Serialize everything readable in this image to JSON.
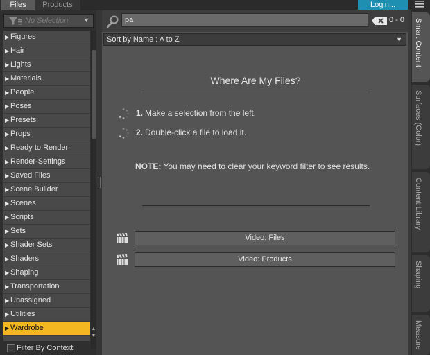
{
  "top_tabs": {
    "files": "Files",
    "products": "Products"
  },
  "login": {
    "label": "Login..."
  },
  "selection": {
    "placeholder": "No Selection"
  },
  "folders": [
    "Figures",
    "Hair",
    "Lights",
    "Materials",
    "People",
    "Poses",
    "Presets",
    "Props",
    "Ready to Render",
    "Render-Settings",
    "Saved Files",
    "Scene Builder",
    "Scenes",
    "Scripts",
    "Sets",
    "Shader Sets",
    "Shaders",
    "Shaping",
    "Transportation",
    "Unassigned",
    "Utilities",
    "Wardrobe"
  ],
  "selected_folder": "Wardrobe",
  "filter": {
    "label": "Filter By Context",
    "checked": false
  },
  "search": {
    "value": "pa",
    "count": "0 - 0"
  },
  "sort": {
    "label": "Sort by Name : A to Z"
  },
  "help": {
    "title": "Where Are My Files?",
    "step1_num": "1.",
    "step1_text": "Make a selection from the left.",
    "step2_num": "2.",
    "step2_text": "Double-click a file to load it.",
    "note_label": "NOTE:",
    "note_text": " You may need to clear your keyword filter to see results."
  },
  "videos": {
    "files": "Video: Files",
    "products": "Video:  Products"
  },
  "side_tabs": {
    "smart_content": "Smart Content",
    "surfaces": "Surfaces (Color)",
    "content_library": "Content Library",
    "shaping": "Shaping",
    "measure": "Measure"
  },
  "colors": {
    "accent": "#f3b721",
    "login": "#1e8fb0",
    "panel": "#545454"
  },
  "icons": [
    "filter-funnel-icon",
    "search-magnifier-icon",
    "clear-search-icon",
    "loading-spinner-icon",
    "video-clapper-icon",
    "hamburger-menu-icon"
  ]
}
